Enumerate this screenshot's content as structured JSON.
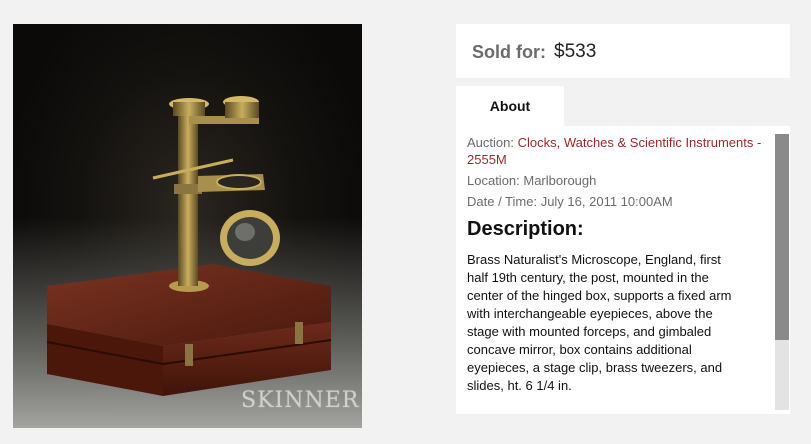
{
  "photo": {
    "icon": "microscope-photo",
    "watermark": "SKINNER"
  },
  "sale": {
    "label": "Sold for:",
    "price": "$533"
  },
  "tabs": [
    {
      "label": "About",
      "active": true
    }
  ],
  "about": {
    "auction_prefix": "Auction: ",
    "auction_name": "Clocks, Watches & Scientific Instruments - 2555M",
    "location": "Location: Marlborough",
    "datetime": "Date / Time: July 16, 2011 10:00AM",
    "description_heading": "Description:",
    "description": "Brass Naturalist's Microscope, England, first half 19th century, the post, mounted in the center of the hinged box, supports a fixed arm with interchangeable eyepieces, above the stage with mounted forceps, and gimbaled concave mirror, box contains additional eyepieces, a stage clip, brass tweezers, and slides, ht. 6 1/4 in."
  },
  "colors": {
    "link": "#9a2a2a",
    "muted": "#6b6b6b",
    "scrollbar_thumb": "#8a8a8a"
  }
}
